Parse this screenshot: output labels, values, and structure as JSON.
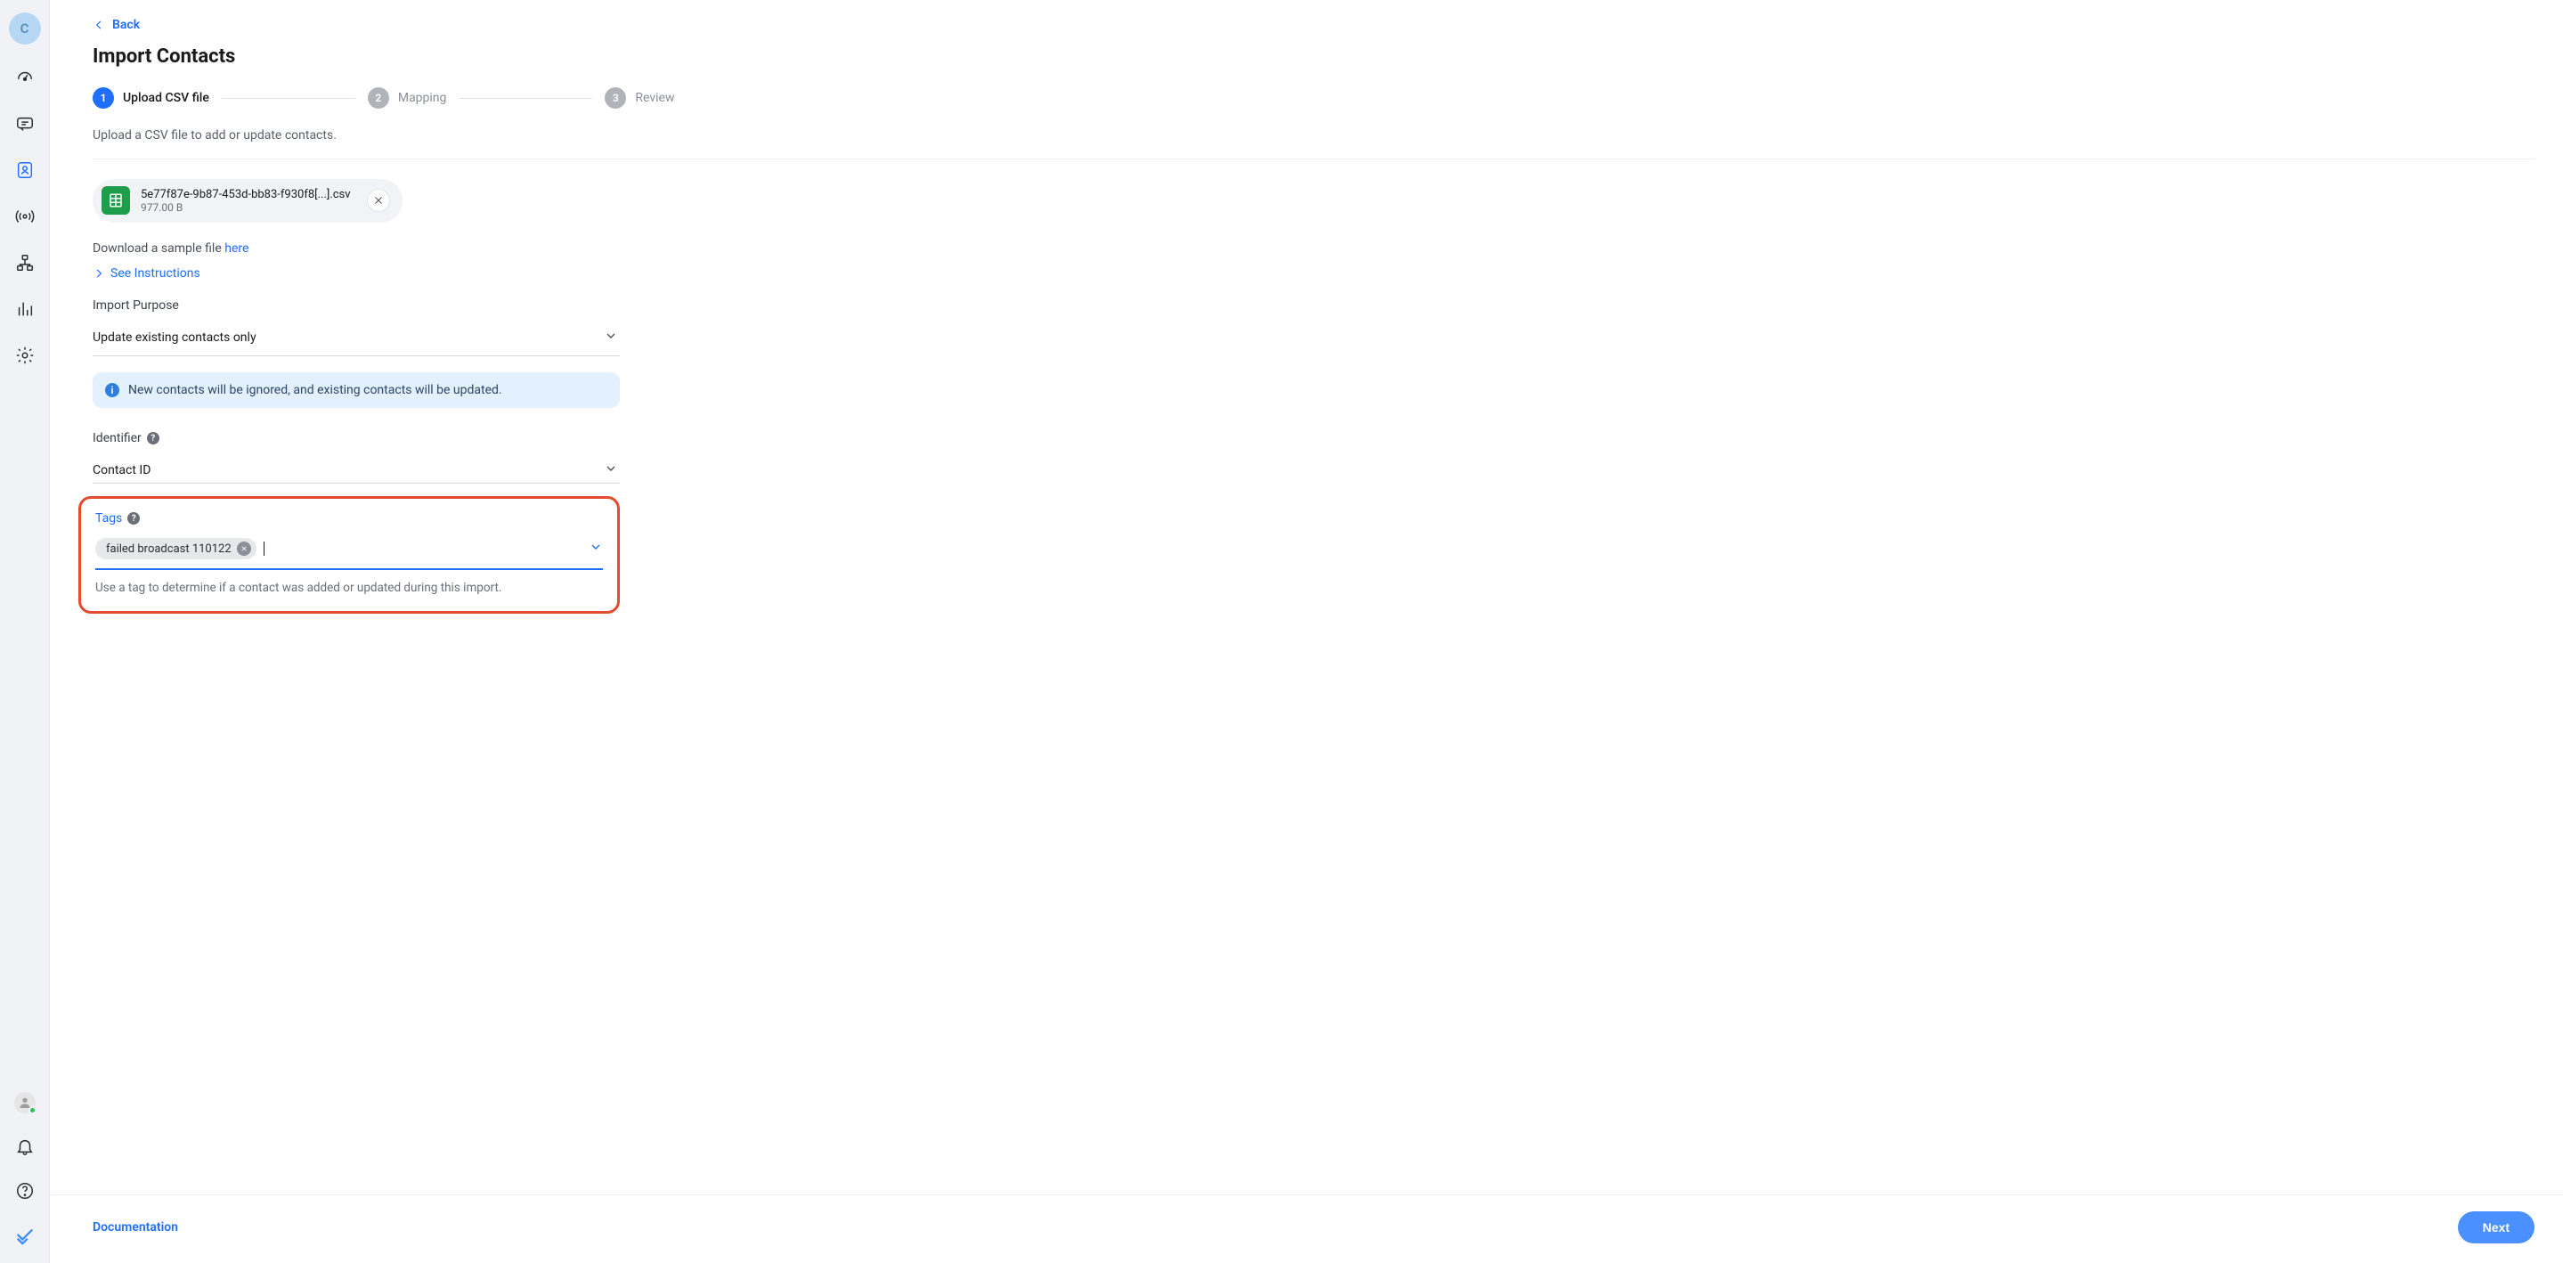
{
  "sidebar": {
    "avatar_letter": "C"
  },
  "header": {
    "back_label": "Back",
    "title": "Import Contacts"
  },
  "stepper": {
    "steps": [
      {
        "num": "1",
        "label": "Upload CSV file",
        "active": true
      },
      {
        "num": "2",
        "label": "Mapping",
        "active": false
      },
      {
        "num": "3",
        "label": "Review",
        "active": false
      }
    ]
  },
  "upload": {
    "description": "Upload a CSV file to add or update contacts.",
    "file_name": "5e77f87e-9b87-453d-bb83-f930f8[...].csv",
    "file_size": "977.00 B",
    "sample_prefix": "Download a sample file ",
    "sample_link": "here",
    "instructions_label": "See Instructions"
  },
  "purpose": {
    "label": "Import Purpose",
    "value": "Update existing contacts only",
    "info_text": "New contacts will be ignored, and existing contacts will be updated."
  },
  "identifier": {
    "label": "Identifier",
    "value": "Contact ID"
  },
  "tags": {
    "label": "Tags",
    "chip_text": "failed broadcast 110122",
    "help_text": "Use a tag to determine if a contact was added or updated during this import."
  },
  "footer": {
    "doc_label": "Documentation",
    "next_label": "Next"
  }
}
